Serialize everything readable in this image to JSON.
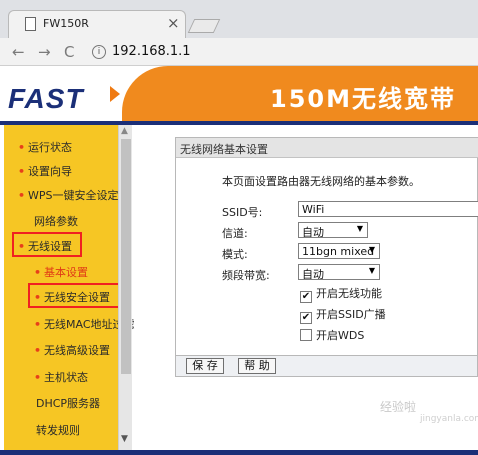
{
  "browser": {
    "tab_title": "FW150R",
    "tab_close": "×",
    "back": "←",
    "forward": "→",
    "reload": "C",
    "info_icon": "i",
    "address": "192.168.1.1"
  },
  "header": {
    "logo": "FAST",
    "banner": "150M无线宽带"
  },
  "sidebar": {
    "items": [
      {
        "label": "运行状态",
        "bullet": true,
        "highlight": false
      },
      {
        "label": "设置向导",
        "bullet": true,
        "highlight": false
      },
      {
        "label": "WPS一键安全设定",
        "bullet": true,
        "highlight": false
      },
      {
        "label": "网络参数",
        "bullet": false,
        "highlight": false
      },
      {
        "label": "无线设置",
        "bullet": true,
        "highlight": true
      },
      {
        "label": "基本设置",
        "bullet": true,
        "highlight": false
      },
      {
        "label": "无线安全设置",
        "bullet": true,
        "highlight": true
      },
      {
        "label": "无线MAC地址过滤",
        "bullet": true,
        "highlight": false
      },
      {
        "label": "无线高级设置",
        "bullet": true,
        "highlight": false
      },
      {
        "label": "主机状态",
        "bullet": true,
        "highlight": false
      },
      {
        "label": "DHCP服务器",
        "bullet": false,
        "highlight": false
      },
      {
        "label": "转发规则",
        "bullet": false,
        "highlight": false
      }
    ],
    "bullet_char": "•",
    "scroll_up": "▲",
    "scroll_down": "▼"
  },
  "panel": {
    "title": "无线网络基本设置",
    "description": "本页面设置路由器无线网络的基本参数。",
    "fields": {
      "ssid": {
        "label": "SSID号:",
        "value": "WiFi"
      },
      "channel": {
        "label": "信道:",
        "value": "自动"
      },
      "mode": {
        "label": "模式:",
        "value": "11bgn mixed"
      },
      "bandwidth": {
        "label": "频段带宽:",
        "value": "自动"
      }
    },
    "select_arrow": "▼",
    "checkboxes": [
      {
        "label": "开启无线功能",
        "checked": true
      },
      {
        "label": "开启SSID广播",
        "checked": true
      },
      {
        "label": "开启WDS",
        "checked": false
      }
    ],
    "check_mark": "✔",
    "buttons": {
      "save": "保 存",
      "help": "帮 助"
    }
  },
  "watermark": {
    "text": "经验啦",
    "sub": "jingyanla.com"
  },
  "colors": {
    "brand_blue": "#1b2f78",
    "banner_orange": "#f08a1e",
    "sidebar_yellow": "#f6c624",
    "highlight_red": "#f02121",
    "active_menu": "#e03a16"
  }
}
